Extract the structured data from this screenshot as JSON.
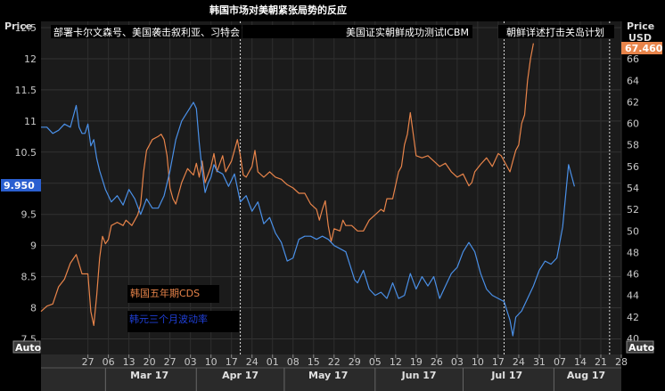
{
  "chart_data": {
    "type": "line",
    "title": "韩国市场对美朝紧张局势的反应",
    "x_tick_labels": [
      "27",
      "06",
      "13",
      "20",
      "27",
      "03",
      "10",
      "17",
      "24",
      "01",
      "08",
      "15",
      "22",
      "29",
      "05",
      "12",
      "19",
      "26",
      "03",
      "10",
      "17",
      "24",
      "31",
      "07",
      "14",
      "21",
      "28"
    ],
    "x_months": [
      "Mar 17",
      "Apr 17",
      "May 17",
      "Jun 17",
      "Jul 17",
      "Aug 17"
    ],
    "left_axis": {
      "title": "Price",
      "ylim": [
        7.25,
        12.6
      ],
      "ticks": [
        "12.5",
        "12",
        "11.5",
        "11",
        "10.5",
        "10",
        "9.5",
        "9",
        "8.5",
        "8",
        "7.5"
      ]
    },
    "right_axis": {
      "title": "Price",
      "unit": "USD",
      "ylim": [
        38.5,
        69.5
      ],
      "ticks": [
        "66",
        "64",
        "62",
        "60",
        "58",
        "56",
        "54",
        "52",
        "50",
        "48",
        "46",
        "44",
        "42",
        "40"
      ]
    },
    "last_value_left": "9.950",
    "last_value_right": "67.460",
    "auto_label": "Auto",
    "events": [
      {
        "label": "部署卡尔文森号、美国袭击叙利亚、习特会",
        "x": 68
      },
      {
        "label": "美国证实朝鲜成功测试ICBM",
        "x": 158
      },
      {
        "label": "朝鲜详述打击关岛计划",
        "x": 194
      }
    ],
    "series": [
      {
        "name": "韩国五年期CDS",
        "axis": "right",
        "color": "#e8844a",
        "points": [
          [
            0,
            42.5
          ],
          [
            2,
            43
          ],
          [
            4,
            43.2
          ],
          [
            6,
            44.8
          ],
          [
            8,
            45.5
          ],
          [
            10,
            47
          ],
          [
            12,
            47.8
          ],
          [
            14,
            46
          ],
          [
            16,
            46
          ],
          [
            17,
            42.5
          ],
          [
            18,
            41.2
          ],
          [
            19,
            44
          ],
          [
            20,
            47.5
          ],
          [
            21,
            49.5
          ],
          [
            22,
            48.8
          ],
          [
            23,
            49.2
          ],
          [
            24,
            50.5
          ],
          [
            26,
            50.8
          ],
          [
            28,
            50.5
          ],
          [
            29,
            51
          ],
          [
            31,
            50.5
          ],
          [
            33,
            51.5
          ],
          [
            34,
            52.5
          ],
          [
            35,
            55.5
          ],
          [
            36,
            57.5
          ],
          [
            38,
            58.5
          ],
          [
            40,
            58.8
          ],
          [
            41,
            59
          ],
          [
            42,
            58.5
          ],
          [
            43,
            57
          ],
          [
            44,
            54
          ],
          [
            45,
            53
          ],
          [
            46,
            52.5
          ],
          [
            48,
            54.5
          ],
          [
            50,
            55.8
          ],
          [
            52,
            55.2
          ],
          [
            53,
            56.3
          ],
          [
            54,
            55
          ],
          [
            55,
            56.5
          ],
          [
            56,
            54.5
          ],
          [
            58,
            56
          ],
          [
            59,
            57.2
          ],
          [
            60,
            55.5
          ],
          [
            62,
            57
          ],
          [
            63,
            55.5
          ],
          [
            64,
            56
          ],
          [
            65,
            56.5
          ],
          [
            66,
            57.5
          ],
          [
            67,
            58.5
          ],
          [
            68,
            57
          ],
          [
            69,
            55.2
          ],
          [
            70,
            55
          ],
          [
            71,
            55.5
          ],
          [
            72,
            56
          ],
          [
            73,
            57.5
          ],
          [
            74,
            55.5
          ],
          [
            76,
            55
          ],
          [
            78,
            55.5
          ],
          [
            80,
            55
          ],
          [
            82,
            54.8
          ],
          [
            84,
            54.3
          ],
          [
            86,
            54
          ],
          [
            88,
            53.5
          ],
          [
            90,
            53.5
          ],
          [
            92,
            52.5
          ],
          [
            94,
            52
          ],
          [
            95,
            51
          ],
          [
            96,
            52
          ],
          [
            97,
            52.8
          ],
          [
            98,
            50.5
          ],
          [
            99,
            49
          ],
          [
            100,
            50.2
          ],
          [
            102,
            50
          ],
          [
            103,
            51
          ],
          [
            104,
            50.5
          ],
          [
            106,
            50.5
          ],
          [
            108,
            50
          ],
          [
            110,
            50
          ],
          [
            112,
            51
          ],
          [
            114,
            51.5
          ],
          [
            116,
            52
          ],
          [
            117,
            51.8
          ],
          [
            118,
            53
          ],
          [
            120,
            53
          ],
          [
            122,
            55.5
          ],
          [
            123,
            56
          ],
          [
            124,
            58
          ],
          [
            125,
            59
          ],
          [
            126,
            61
          ],
          [
            127,
            59
          ],
          [
            128,
            57
          ],
          [
            130,
            56.8
          ],
          [
            132,
            57
          ],
          [
            134,
            56.5
          ],
          [
            136,
            56
          ],
          [
            138,
            56.3
          ],
          [
            140,
            55.5
          ],
          [
            142,
            55
          ],
          [
            144,
            55.3
          ],
          [
            146,
            54.2
          ],
          [
            147,
            54.5
          ],
          [
            148,
            55.5
          ],
          [
            150,
            56.2
          ],
          [
            152,
            56.8
          ],
          [
            154,
            56
          ],
          [
            156,
            57.2
          ],
          [
            157,
            57
          ],
          [
            158,
            56.5
          ],
          [
            159,
            56
          ],
          [
            160,
            55.5
          ],
          [
            161,
            56.5
          ],
          [
            162,
            57.5
          ],
          [
            163,
            58
          ],
          [
            164,
            60
          ],
          [
            165,
            60.8
          ],
          [
            166,
            64
          ],
          [
            167,
            66
          ],
          [
            168,
            67.46
          ]
        ]
      },
      {
        "name": "韩元三个月波动率",
        "axis": "left",
        "color": "#4a90e8",
        "points": [
          [
            0,
            10.9
          ],
          [
            2,
            10.9
          ],
          [
            4,
            10.8
          ],
          [
            6,
            10.85
          ],
          [
            8,
            10.95
          ],
          [
            10,
            10.9
          ],
          [
            12,
            11.25
          ],
          [
            13,
            10.9
          ],
          [
            14,
            10.8
          ],
          [
            15,
            10.8
          ],
          [
            16,
            10.95
          ],
          [
            17,
            10.6
          ],
          [
            18,
            10.7
          ],
          [
            19,
            10.4
          ],
          [
            20,
            10.2
          ],
          [
            22,
            9.9
          ],
          [
            24,
            9.7
          ],
          [
            26,
            9.8
          ],
          [
            28,
            9.65
          ],
          [
            30,
            9.9
          ],
          [
            32,
            9.75
          ],
          [
            34,
            9.5
          ],
          [
            36,
            9.75
          ],
          [
            38,
            9.6
          ],
          [
            40,
            9.6
          ],
          [
            42,
            9.8
          ],
          [
            44,
            10.2
          ],
          [
            46,
            10.7
          ],
          [
            48,
            11
          ],
          [
            50,
            11.15
          ],
          [
            52,
            11.3
          ],
          [
            53,
            11.2
          ],
          [
            54,
            10.65
          ],
          [
            55,
            10.2
          ],
          [
            56,
            9.85
          ],
          [
            57,
            10
          ],
          [
            58,
            10.1
          ],
          [
            59,
            10.3
          ],
          [
            60,
            10.2
          ],
          [
            62,
            10.15
          ],
          [
            64,
            9.95
          ],
          [
            66,
            10.15
          ],
          [
            68,
            9.7
          ],
          [
            70,
            9.8
          ],
          [
            72,
            9.55
          ],
          [
            74,
            9.7
          ],
          [
            76,
            9.35
          ],
          [
            78,
            9.45
          ],
          [
            80,
            9.2
          ],
          [
            82,
            9.05
          ],
          [
            84,
            8.75
          ],
          [
            86,
            8.8
          ],
          [
            88,
            9.1
          ],
          [
            90,
            9.15
          ],
          [
            92,
            9.15
          ],
          [
            94,
            9.1
          ],
          [
            96,
            9.15
          ],
          [
            98,
            9.1
          ],
          [
            100,
            9
          ],
          [
            102,
            8.95
          ],
          [
            104,
            8.9
          ],
          [
            106,
            8.6
          ],
          [
            107,
            8.45
          ],
          [
            108,
            8.4
          ],
          [
            110,
            8.6
          ],
          [
            112,
            8.3
          ],
          [
            114,
            8.2
          ],
          [
            116,
            8.25
          ],
          [
            118,
            8.15
          ],
          [
            120,
            8.4
          ],
          [
            122,
            8.15
          ],
          [
            124,
            8.2
          ],
          [
            126,
            8.55
          ],
          [
            128,
            8.3
          ],
          [
            130,
            8.5
          ],
          [
            132,
            8.35
          ],
          [
            134,
            8.5
          ],
          [
            136,
            8.15
          ],
          [
            138,
            8.35
          ],
          [
            140,
            8.55
          ],
          [
            142,
            8.65
          ],
          [
            144,
            8.9
          ],
          [
            146,
            9.05
          ],
          [
            148,
            8.9
          ],
          [
            150,
            8.55
          ],
          [
            152,
            8.3
          ],
          [
            154,
            8.2
          ],
          [
            156,
            8.15
          ],
          [
            158,
            8.1
          ],
          [
            160,
            7.8
          ],
          [
            161,
            7.55
          ],
          [
            162,
            7.85
          ],
          [
            164,
            7.95
          ],
          [
            166,
            8.15
          ],
          [
            168,
            8.35
          ],
          [
            170,
            8.6
          ],
          [
            172,
            8.75
          ],
          [
            174,
            8.7
          ],
          [
            176,
            8.8
          ],
          [
            178,
            9.3
          ],
          [
            180,
            10.3
          ],
          [
            182,
            9.95
          ]
        ]
      }
    ]
  },
  "legend": {
    "cds_label": "韩国五年期CDS",
    "vol_label": "韩元三个月波动率"
  }
}
